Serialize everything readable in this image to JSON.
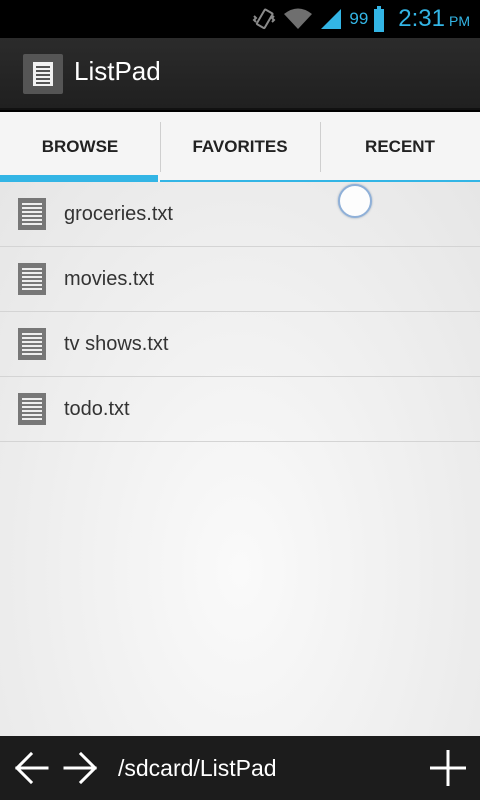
{
  "status_bar": {
    "battery_level": "99",
    "time": "2:31",
    "ampm": "PM",
    "accent_color": "#33b5e5",
    "icons": [
      "vibrate-icon",
      "wifi-icon",
      "signal-icon",
      "battery-icon"
    ]
  },
  "action_bar": {
    "title": "ListPad",
    "icon": "document-icon"
  },
  "tabs": [
    {
      "label": "BROWSE",
      "active": true
    },
    {
      "label": "FAVORITES",
      "active": false
    },
    {
      "label": "RECENT",
      "active": false
    }
  ],
  "files": [
    {
      "name": "groceries.txt",
      "icon": "text-file-icon"
    },
    {
      "name": "movies.txt",
      "icon": "text-file-icon"
    },
    {
      "name": "tv shows.txt",
      "icon": "text-file-icon"
    },
    {
      "name": "todo.txt",
      "icon": "text-file-icon"
    }
  ],
  "bottom_bar": {
    "path": "/sdcard/ListPad",
    "back_icon": "arrow-left-icon",
    "forward_icon": "arrow-right-icon",
    "add_icon": "plus-icon"
  }
}
